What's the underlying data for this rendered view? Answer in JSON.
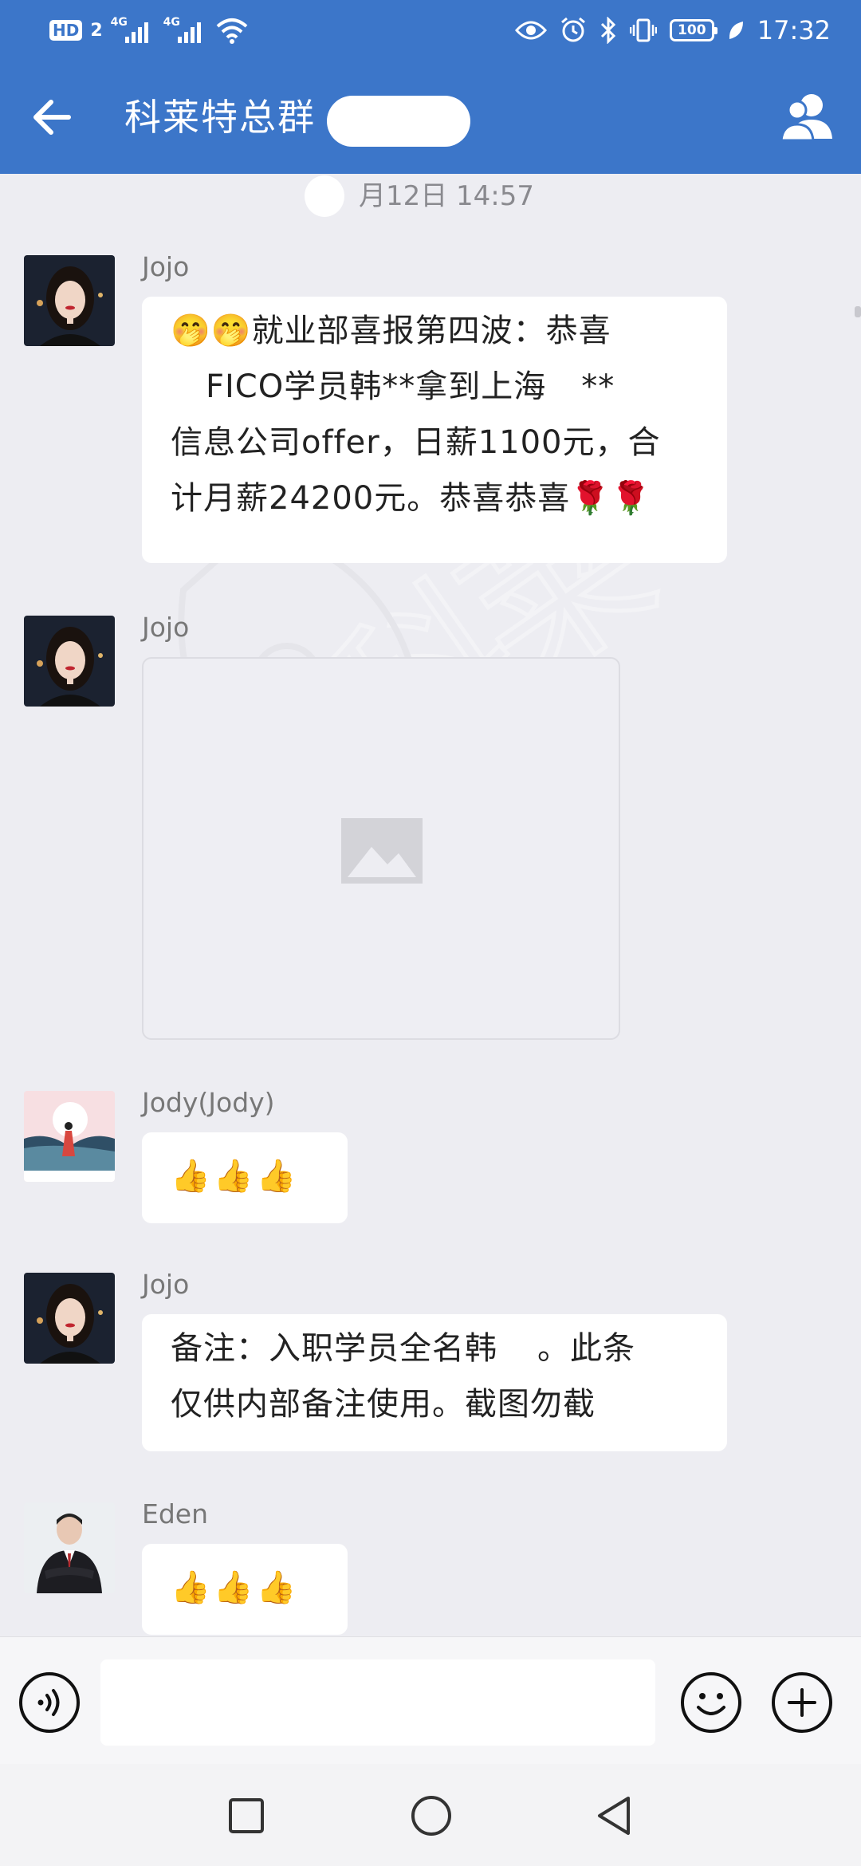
{
  "status_bar": {
    "hd_badge": "HD",
    "sim_number": "2",
    "net_1": "4G",
    "net_2": "4G",
    "battery": "100",
    "time": "17:32"
  },
  "header": {
    "title": "科莱特总群",
    "back_icon": "arrow-left-icon",
    "members_icon": "group-members-icon"
  },
  "time_separator": "月12日  14:57",
  "messages": [
    {
      "sender": "Jojo",
      "lines": [
        "🤭🤭就业部喜报第四波：恭喜",
        "FICO学员韩**拿到上海",
        "信息公司offer，日薪1100元，合",
        "计月薪24200元。恭喜恭喜🌹🌹"
      ],
      "line2_after": "**"
    },
    {
      "sender": "Jojo",
      "image_icon": "image-placeholder-icon"
    },
    {
      "sender": "Jody(Jody)",
      "content": "👍👍👍"
    },
    {
      "sender": "Jojo",
      "lines": [
        "备注：入职学员全名韩",
        "。此条",
        "仅供内部备注使用。截图勿截"
      ]
    },
    {
      "sender": "Eden",
      "content": "👍👍👍"
    }
  ],
  "input_bar": {
    "voice_icon": "voice-input-icon",
    "emoji_icon": "emoji-icon",
    "plus_icon": "plus-icon",
    "placeholder": ""
  },
  "nav_bar": {
    "recents_icon": "square-recents-icon",
    "home_icon": "circle-home-icon",
    "back_icon": "triangle-back-icon"
  },
  "colors": {
    "header_blue": "#3c76c9",
    "chat_background": "#ededf2",
    "bubble": "#ffffff"
  }
}
